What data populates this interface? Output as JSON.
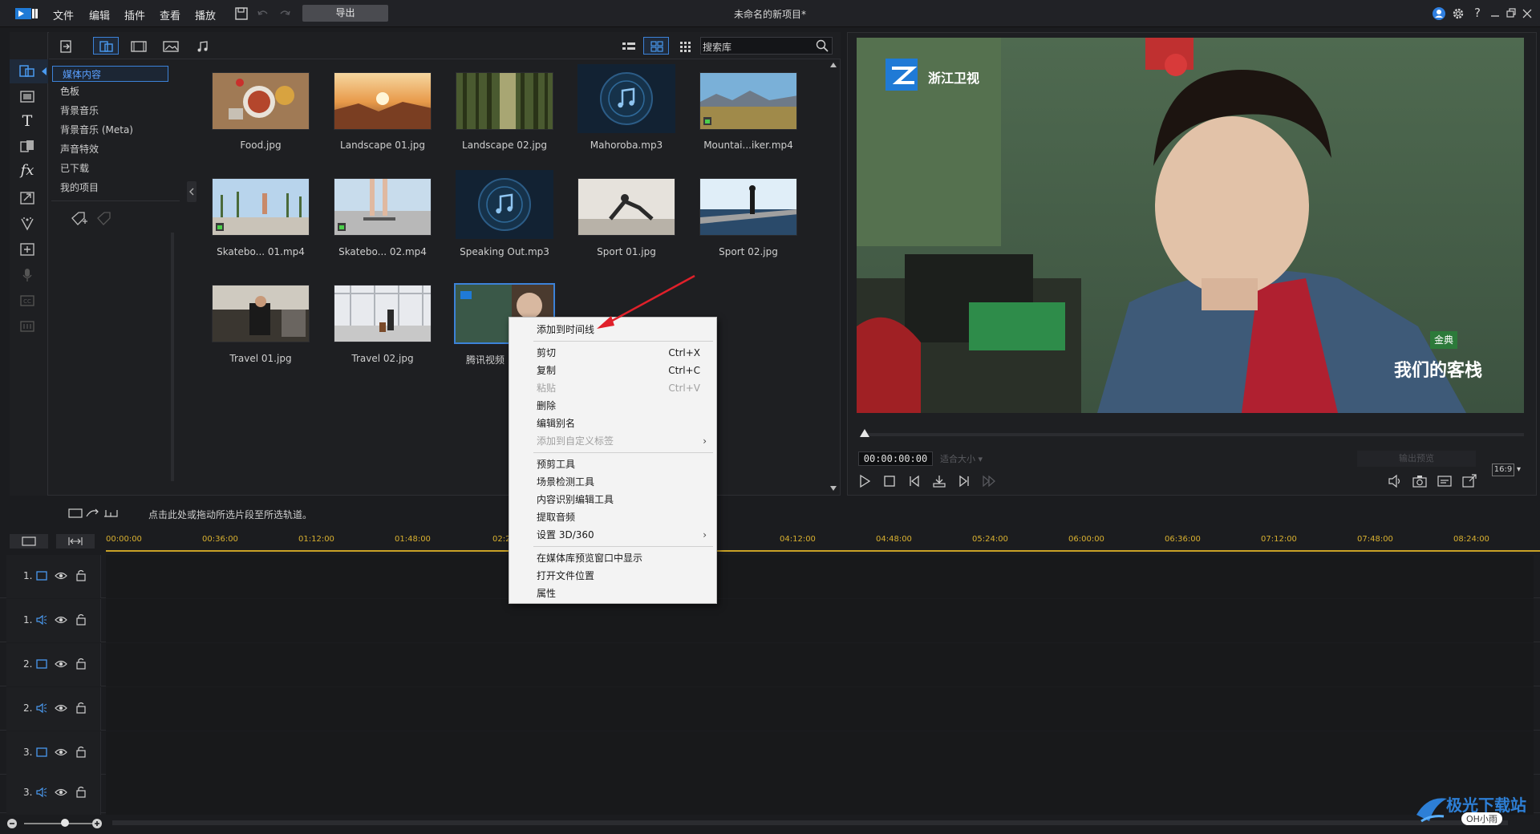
{
  "app": {
    "title": "未命名的新项目*"
  },
  "menu": [
    "文件",
    "编辑",
    "插件",
    "查看",
    "播放"
  ],
  "toolbar": {
    "export_label": "导出"
  },
  "library": {
    "search_placeholder": "搜索库",
    "categories": [
      "媒体内容",
      "色板",
      "背景音乐",
      "背景音乐 (Meta)",
      "声音特效",
      "已下载",
      "我的项目"
    ],
    "items": [
      {
        "name": "Food.jpg"
      },
      {
        "name": "Landscape 01.jpg"
      },
      {
        "name": "Landscape 02.jpg"
      },
      {
        "name": "Mahoroba.mp3"
      },
      {
        "name": "Mountai...iker.mp4"
      },
      {
        "name": "Skatebo... 01.mp4"
      },
      {
        "name": "Skatebo... 02.mp4"
      },
      {
        "name": "Speaking Out.mp3"
      },
      {
        "name": "Sport 01.jpg"
      },
      {
        "name": "Sport 02.jpg"
      },
      {
        "name": "Travel 01.jpg"
      },
      {
        "name": "Travel 02.jpg"
      },
      {
        "name": "腾讯视频"
      }
    ]
  },
  "preview": {
    "timecode": "00:00:00:00",
    "fit_label": "适合大小",
    "output_preview_label": "输出预览",
    "ratio": "16:9",
    "channel_logo": "浙江卫视",
    "show_logo_top": "金典",
    "show_logo": "我们的客栈"
  },
  "timeline": {
    "hint": "点击此处或拖动所选片段至所选轨道。",
    "ruler": [
      "00:00:00",
      "00:36:00",
      "01:12:00",
      "01:48:00",
      "02:2",
      "04:12:00",
      "04:48:00",
      "05:24:00",
      "06:00:00",
      "06:36:00",
      "07:12:00",
      "07:48:00",
      "08:24:00"
    ],
    "tracks": [
      {
        "num": "1.",
        "kind": "video"
      },
      {
        "num": "1.",
        "kind": "audio"
      },
      {
        "num": "2.",
        "kind": "video"
      },
      {
        "num": "2.",
        "kind": "audio"
      },
      {
        "num": "3.",
        "kind": "video"
      },
      {
        "num": "3.",
        "kind": "audio"
      }
    ]
  },
  "context_menu": {
    "items": [
      {
        "label": "添加到时间线",
        "shortcut": "",
        "disabled": false
      },
      {
        "label": "剪切",
        "shortcut": "Ctrl+X",
        "disabled": false
      },
      {
        "label": "复制",
        "shortcut": "Ctrl+C",
        "disabled": false
      },
      {
        "label": "粘贴",
        "shortcut": "Ctrl+V",
        "disabled": true
      },
      {
        "label": "删除",
        "shortcut": "",
        "disabled": false
      },
      {
        "label": "编辑别名",
        "shortcut": "",
        "disabled": false
      },
      {
        "label": "添加到自定义标签",
        "shortcut": "›",
        "disabled": true
      },
      {
        "label": "预剪工具",
        "shortcut": "",
        "disabled": false
      },
      {
        "label": "场景检测工具",
        "shortcut": "",
        "disabled": false
      },
      {
        "label": "内容识别编辑工具",
        "shortcut": "",
        "disabled": false
      },
      {
        "label": "提取音频",
        "shortcut": "",
        "disabled": false
      },
      {
        "label": "设置 3D/360",
        "shortcut": "›",
        "disabled": false
      },
      {
        "label": "在媒体库预览窗口中显示",
        "shortcut": "",
        "disabled": false
      },
      {
        "label": "打开文件位置",
        "shortcut": "",
        "disabled": false
      },
      {
        "label": "属性",
        "shortcut": "",
        "disabled": false
      }
    ]
  },
  "watermark": {
    "text": "极光下载站",
    "sub": "OH小雨"
  },
  "colors": {
    "accent": "#3c82d8",
    "ruler": "#d8b030",
    "annotation_arrow": "#e0202a"
  }
}
